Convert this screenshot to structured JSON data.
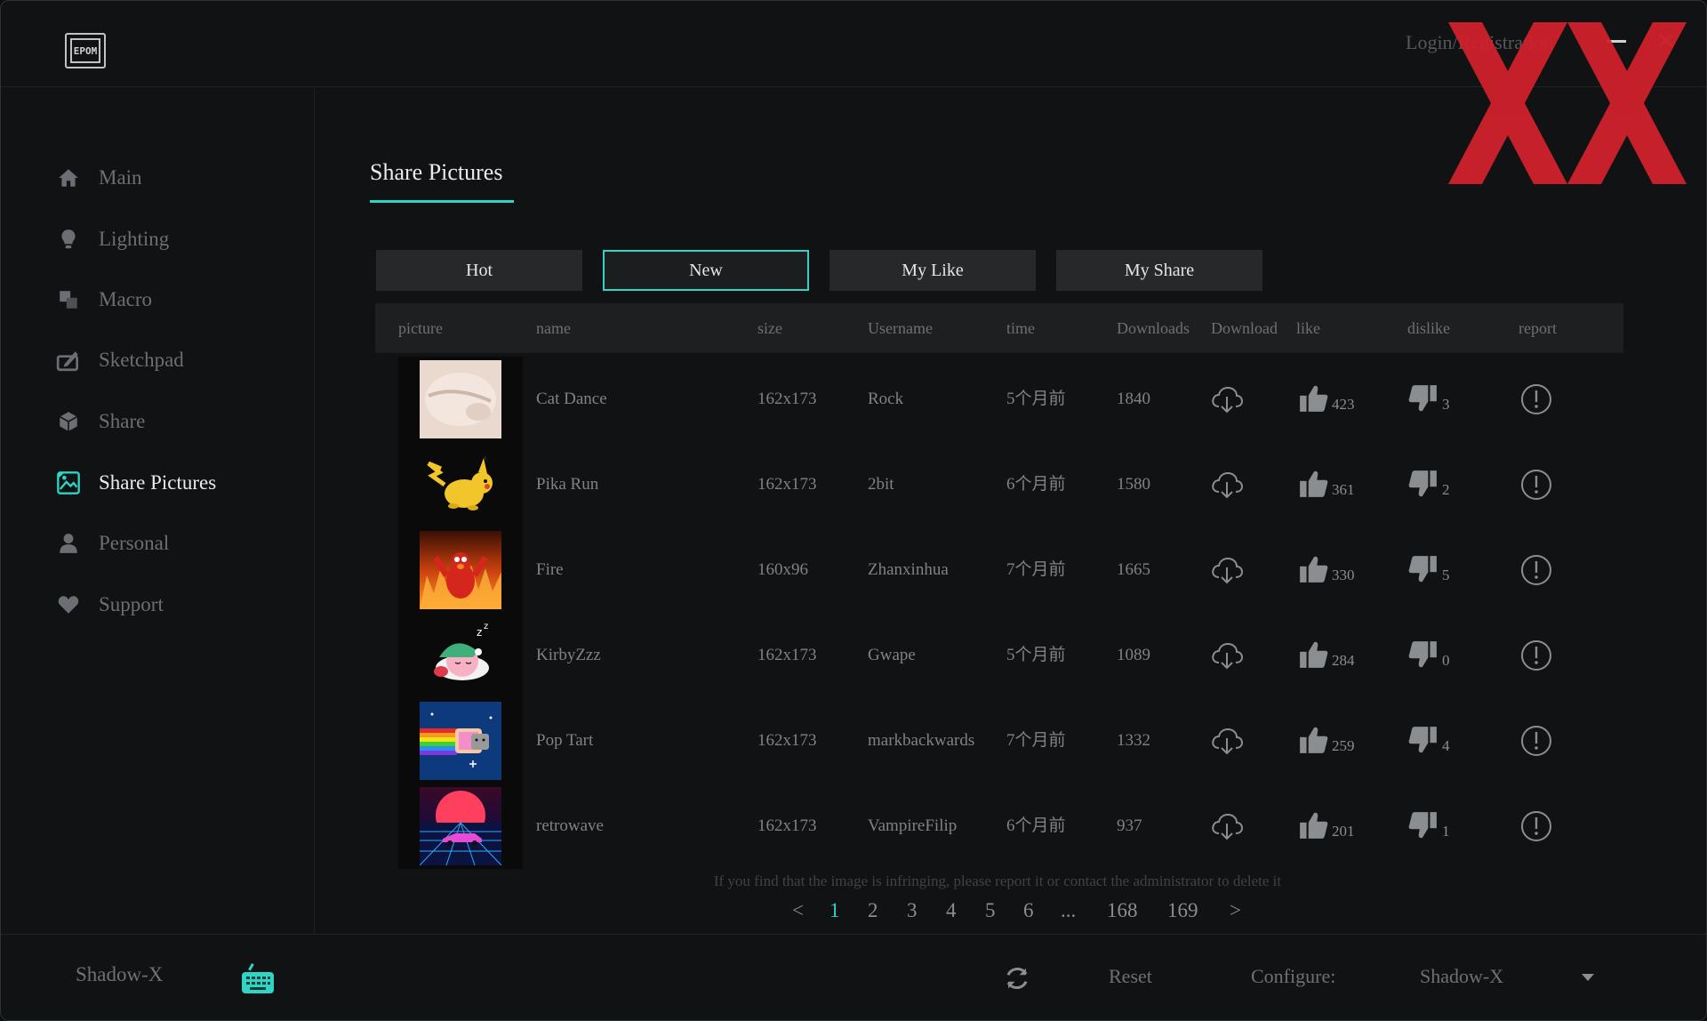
{
  "app": {
    "logo_text": "EPOM",
    "login_label": "Login/Registration"
  },
  "sidebar": {
    "items": [
      {
        "label": "Main",
        "icon": "home-icon"
      },
      {
        "label": "Lighting",
        "icon": "bulb-icon"
      },
      {
        "label": "Macro",
        "icon": "macro-icon"
      },
      {
        "label": "Sketchpad",
        "icon": "sketchpad-icon"
      },
      {
        "label": "Share",
        "icon": "cube-icon"
      },
      {
        "label": "Share Pictures",
        "icon": "picture-icon",
        "active": true
      },
      {
        "label": "Personal",
        "icon": "person-icon"
      },
      {
        "label": "Support",
        "icon": "heart-icon"
      }
    ]
  },
  "page": {
    "title": "Share Pictures",
    "tabs": [
      {
        "label": "Hot"
      },
      {
        "label": "New",
        "active": true
      },
      {
        "label": "My Like"
      },
      {
        "label": "My Share"
      }
    ]
  },
  "table": {
    "headers": [
      "picture",
      "name",
      "size",
      "Username",
      "time",
      "Downloads",
      "Download",
      "like",
      "dislike",
      "report"
    ],
    "rows": [
      {
        "name": "Cat Dance",
        "size": "162x173",
        "username": "Rock",
        "time": "5个月前",
        "downloads": "1840",
        "likes": "423",
        "dislikes": "3",
        "thumb": "cat-paw"
      },
      {
        "name": "Pika Run",
        "size": "162x173",
        "username": "2bit",
        "time": "6个月前",
        "downloads": "1580",
        "likes": "361",
        "dislikes": "2",
        "thumb": "pikachu"
      },
      {
        "name": "Fire",
        "size": "160x96",
        "username": "Zhanxinhua",
        "time": "7个月前",
        "downloads": "1665",
        "likes": "330",
        "dislikes": "5",
        "thumb": "fire"
      },
      {
        "name": "KirbyZzz",
        "size": "162x173",
        "username": "Gwape",
        "time": "5个月前",
        "downloads": "1089",
        "likes": "284",
        "dislikes": "0",
        "thumb": "kirby"
      },
      {
        "name": "Pop Tart",
        "size": "162x173",
        "username": "markbackwards",
        "time": "7个月前",
        "downloads": "1332",
        "likes": "259",
        "dislikes": "4",
        "thumb": "nyancat"
      },
      {
        "name": "retrowave",
        "size": "162x173",
        "username": "VampireFilip",
        "time": "6个月前",
        "downloads": "937",
        "likes": "201",
        "dislikes": "1",
        "thumb": "retrowave"
      }
    ]
  },
  "notice": "If you find that the image is infringing, please report it or contact the administrator to delete it",
  "pagination": {
    "prev": "<",
    "next": ">",
    "pages": [
      "1",
      "2",
      "3",
      "4",
      "5",
      "6",
      "...",
      "168",
      "169"
    ],
    "current": "1"
  },
  "footer": {
    "device_name": "Shadow-X",
    "reset_label": "Reset",
    "configure_label": "Configure:",
    "configure_value": "Shadow-X"
  },
  "colors": {
    "accent": "#2fd4c4",
    "background": "#111213",
    "header_row": "#1d1f21",
    "tab": "#26282a",
    "watermark": "#d0222c"
  }
}
